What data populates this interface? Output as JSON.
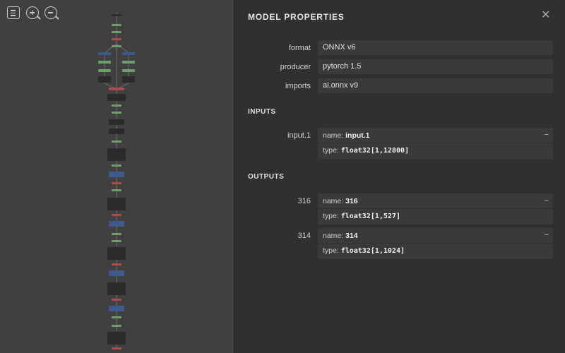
{
  "toolbar": {
    "menu_icon": "menu-icon",
    "zoom_in_icon": "zoom-in-icon",
    "zoom_out_icon": "zoom-out-icon"
  },
  "panel": {
    "title": "MODEL PROPERTIES",
    "close_glyph": "✕",
    "properties": [
      {
        "label": "format",
        "value": "ONNX v6"
      },
      {
        "label": "producer",
        "value": "pytorch 1.5"
      },
      {
        "label": "imports",
        "value": "ai.onnx v9"
      }
    ],
    "inputs_header": "INPUTS",
    "inputs": [
      {
        "label": "input.1",
        "name": "input.1",
        "type": "float32[1,12800]"
      }
    ],
    "outputs_header": "OUTPUTS",
    "outputs": [
      {
        "label": "316",
        "name": "316",
        "type": "float32[1,527]"
      },
      {
        "label": "314",
        "name": "314",
        "type": "float32[1,1024]"
      }
    ],
    "name_prefix": "name: ",
    "type_prefix": "type: ",
    "toggle_glyph": "−"
  },
  "colors": {
    "node_green": "#6c9e6c",
    "node_blue": "#3e5a8c",
    "node_red": "#b04a4a",
    "node_dark": "#2b2b2b"
  }
}
